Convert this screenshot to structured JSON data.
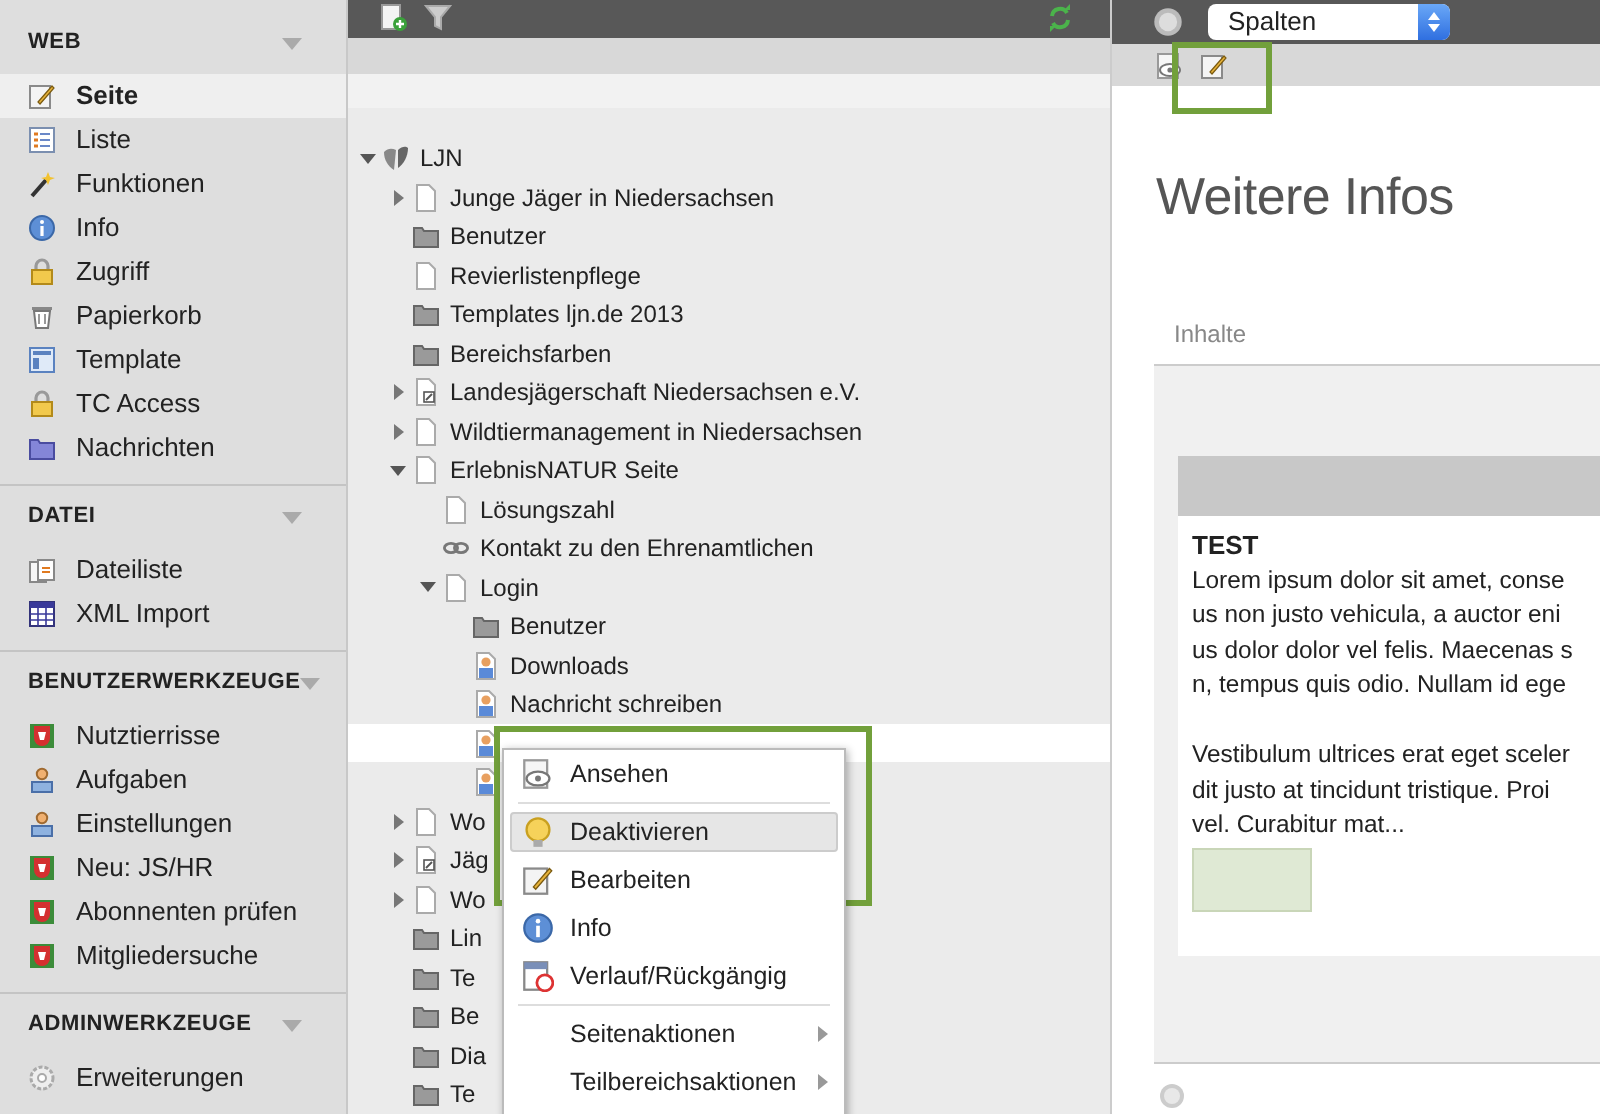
{
  "sidebar": {
    "groups": [
      {
        "title": "WEB",
        "items": [
          {
            "label": "Seite",
            "selected": true
          },
          {
            "label": "Liste",
            "selected": false
          },
          {
            "label": "Funktionen",
            "selected": false
          },
          {
            "label": "Info",
            "selected": false
          },
          {
            "label": "Zugriff",
            "selected": false
          },
          {
            "label": "Papierkorb",
            "selected": false
          },
          {
            "label": "Template",
            "selected": false
          },
          {
            "label": "TC Access",
            "selected": false
          },
          {
            "label": "Nachrichten",
            "selected": false
          }
        ]
      },
      {
        "title": "DATEI",
        "items": [
          {
            "label": "Dateiliste",
            "selected": false
          },
          {
            "label": "XML Import",
            "selected": false
          }
        ]
      },
      {
        "title": "BENUTZERWERKZEUGE",
        "items": [
          {
            "label": "Nutztierrisse",
            "selected": false
          },
          {
            "label": "Aufgaben",
            "selected": false
          },
          {
            "label": "Einstellungen",
            "selected": false
          },
          {
            "label": "Neu: JS/HR",
            "selected": false
          },
          {
            "label": "Abonnenten prüfen",
            "selected": false
          },
          {
            "label": "Mitgliedersuche",
            "selected": false
          }
        ]
      },
      {
        "title": "ADMINWERKZEUGE",
        "items": [
          {
            "label": "Erweiterungen",
            "selected": false
          }
        ]
      }
    ]
  },
  "toolbar": {
    "view_select": "Spalten"
  },
  "tree": [
    {
      "label": "LJN",
      "kind": "root",
      "expanded": true,
      "selected": false,
      "children": [
        {
          "label": "Junge Jäger in Niedersachsen",
          "kind": "page",
          "expanded": false,
          "selected": false
        },
        {
          "label": "Benutzer",
          "kind": "folder",
          "selected": false
        },
        {
          "label": "Revierlistenpflege",
          "kind": "page",
          "selected": false
        },
        {
          "label": "Templates ljn.de 2013",
          "kind": "folder",
          "selected": false
        },
        {
          "label": "Bereichsfarben",
          "kind": "folder",
          "selected": false
        },
        {
          "label": "Landesjägerschaft Niedersachsen e.V.",
          "kind": "shortcut",
          "expanded": false,
          "selected": false
        },
        {
          "label": "Wildtiermanagement in Niedersachsen",
          "kind": "page",
          "expanded": false,
          "selected": false
        },
        {
          "label": "ErlebnisNATUR Seite",
          "kind": "page",
          "expanded": true,
          "selected": false,
          "children": [
            {
              "label": "Lösungszahl",
              "kind": "page",
              "selected": false
            },
            {
              "label": "Kontakt zu den Ehrenamtlichen",
              "kind": "link",
              "selected": false
            },
            {
              "label": "Login",
              "kind": "page",
              "expanded": true,
              "selected": false,
              "children": [
                {
                  "label": "Benutzer",
                  "kind": "folder",
                  "selected": false
                },
                {
                  "label": "Downloads",
                  "kind": "user",
                  "selected": false
                },
                {
                  "label": "Nachricht schreiben",
                  "kind": "user",
                  "selected": false
                },
                {
                  "kind": "user",
                  "selected": true
                },
                {
                  "kind": "user",
                  "selected": false
                }
              ]
            }
          ]
        },
        {
          "label": "Wo",
          "kind": "page",
          "expanded": false,
          "selected": false
        },
        {
          "label": "Jäg",
          "kind": "shortcut",
          "expanded": false,
          "selected": false
        },
        {
          "label": "Wo",
          "kind": "page",
          "expanded": false,
          "selected": false
        },
        {
          "label": "Lin",
          "kind": "folder",
          "selected": false
        },
        {
          "label": "Te",
          "kind": "folder",
          "selected": false
        },
        {
          "label": "Be",
          "kind": "folder",
          "selected": false
        },
        {
          "label": "Dia",
          "kind": "folder",
          "selected": false
        },
        {
          "label": "Te",
          "kind": "folder",
          "selected": false
        }
      ]
    }
  ],
  "context_menu": [
    {
      "kind": "item",
      "label": "Ansehen",
      "selected": false
    },
    {
      "kind": "separator"
    },
    {
      "kind": "item",
      "label": "Deaktivieren",
      "selected": true
    },
    {
      "kind": "item",
      "label": "Bearbeiten",
      "selected": false
    },
    {
      "kind": "item",
      "label": "Info",
      "selected": false
    },
    {
      "kind": "item",
      "label": "Verlauf/Rückgängig",
      "selected": false
    },
    {
      "kind": "separator"
    },
    {
      "kind": "submenu",
      "label": "Seitenaktionen",
      "selected": false
    },
    {
      "kind": "submenu",
      "label": "Teilbereichsaktionen",
      "selected": false
    }
  ],
  "content": {
    "title": "Weitere Infos",
    "tab": "Inhalte",
    "element": {
      "header": "TEST",
      "paragraphs": [
        [
          "Lorem ipsum dolor sit amet, conse",
          "us non justo vehicula, a auctor eni",
          "us dolor dolor vel felis. Maecenas s",
          "n, tempus quis odio. Nullam id ege"
        ],
        [
          "Vestibulum ultrices erat eget sceler",
          "dit justo at tincidunt tristique. Proi",
          "vel. Curabitur mat..."
        ]
      ]
    }
  }
}
